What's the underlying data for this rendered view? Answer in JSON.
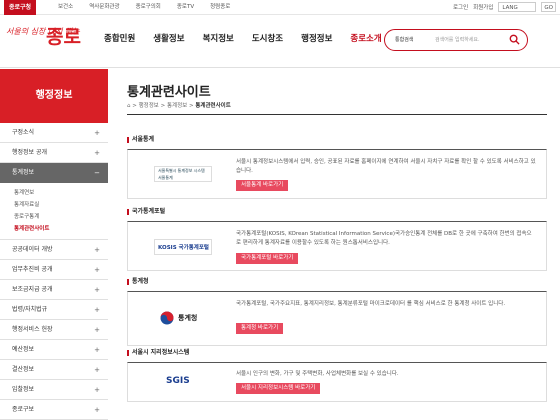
{
  "topbar": {
    "gu_label": "종로구청",
    "links": [
      "보건소",
      "역사문화관광",
      "종로구의회",
      "종로TV",
      "청렴종로"
    ],
    "login": "로그인",
    "join": "회원가입",
    "lang": "LANG",
    "go": "GO"
  },
  "logo": {
    "slogan": "서울의 심장 다시 뛰는",
    "name": "종로"
  },
  "gnb": [
    "종합민원",
    "생활정보",
    "복지정보",
    "도시창조",
    "행정정보",
    "종로소개"
  ],
  "search": {
    "select": "통합검색",
    "placeholder": "검색어를 입력하세요."
  },
  "lnb": {
    "title": "행정정보",
    "items": [
      "구정소식",
      "행정정보 공개",
      "통계정보",
      "공공데이터 개방",
      "업무추진비 공개",
      "보조금지급 공개",
      "법령/자치법규",
      "행정서비스 헌장",
      "예산정보",
      "결산정보",
      "입찰정보",
      "종로구보"
    ],
    "sub": [
      "통계연보",
      "통계자료실",
      "종로구통계",
      "통계관련사이트"
    ]
  },
  "page": {
    "title": "통계관련사이트",
    "breadcrumb": [
      "행정정보",
      "통계정보",
      "통계관련사이트"
    ]
  },
  "sections": [
    {
      "title": "서울통계",
      "logo": "서울특별시 통계정보 시스템",
      "logo_sub": "서울통계",
      "desc": "서울시 통계정보시스템에서 입력, 승인, 공표된 자료를 홈페이지에 연계하여 서울시 자치구 자료를 확인 할 수 있도록 서비스하고 있습니다.",
      "button": "서울통계 바로가기"
    },
    {
      "title": "국가통계포털",
      "logo": "KOSIS 국가통계포털",
      "desc": "국가통계포털(KOSIS, KOrean Statistical Information Service)국가승인통계 전체를 DB로 한 곳에 구축하여 한번의 접속으로 편리하게 통계자료를 이용할수 있도록 하는 원스톱서비스입니다.",
      "button": "국가통계포털 바로가기"
    },
    {
      "title": "통계청",
      "logo": "통계청",
      "desc": "국가통계포털, 국가주요지표, 통계지리정보, 통계분류포털 마이크로데이터 를 핵심 서비스로 한 통계청 사이트 입니다.",
      "button": "통계청 바로가기"
    },
    {
      "title": "서울시 지리정보시스템",
      "logo": "SGIS",
      "desc": "서울시 인구의 변화, 가구 및 주택변화, 사업체변화를 보실 수 있습니다.",
      "button": "서울시 지리정보시스템 바로가기"
    }
  ],
  "colors": {
    "brand": "#c40e1e",
    "button": "#e84a5f",
    "lnb_active": "#666666"
  }
}
